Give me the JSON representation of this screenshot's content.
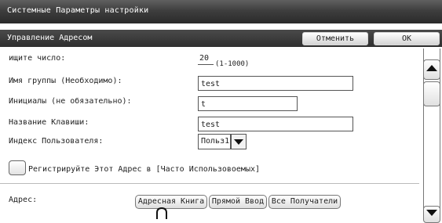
{
  "window_title": "Системные Параметры настройки",
  "header": {
    "title": "Управление Адресом",
    "cancel_label": "Отменить",
    "ok_label": "OK"
  },
  "form": {
    "number": {
      "label": "ищите число:",
      "value": "20",
      "range_note": "(1-1000)"
    },
    "group_name": {
      "label": "Имя группы (Необходимо):",
      "value": "test"
    },
    "initials": {
      "label": "Инициалы (не обязательно):",
      "value": "t"
    },
    "key_name": {
      "label": "Название Клавиши:",
      "value": "test"
    },
    "user_index": {
      "label": "Индекс Пользователя:",
      "value": "Польз1"
    },
    "register_frequent": {
      "label": "Регистрируйте Этот Адрес в [Часто Использовоемых]",
      "checked": false
    },
    "address": {
      "label": "Адрес:",
      "buttons": [
        "Адресная Книга",
        "Прямой Ввод",
        "Все Получатели"
      ]
    }
  },
  "icons": {
    "scroll_up": "triangle-up-icon",
    "scroll_down": "triangle-down-icon",
    "dropdown": "triangle-down-icon",
    "pointer": "finger-pointer-icon"
  }
}
